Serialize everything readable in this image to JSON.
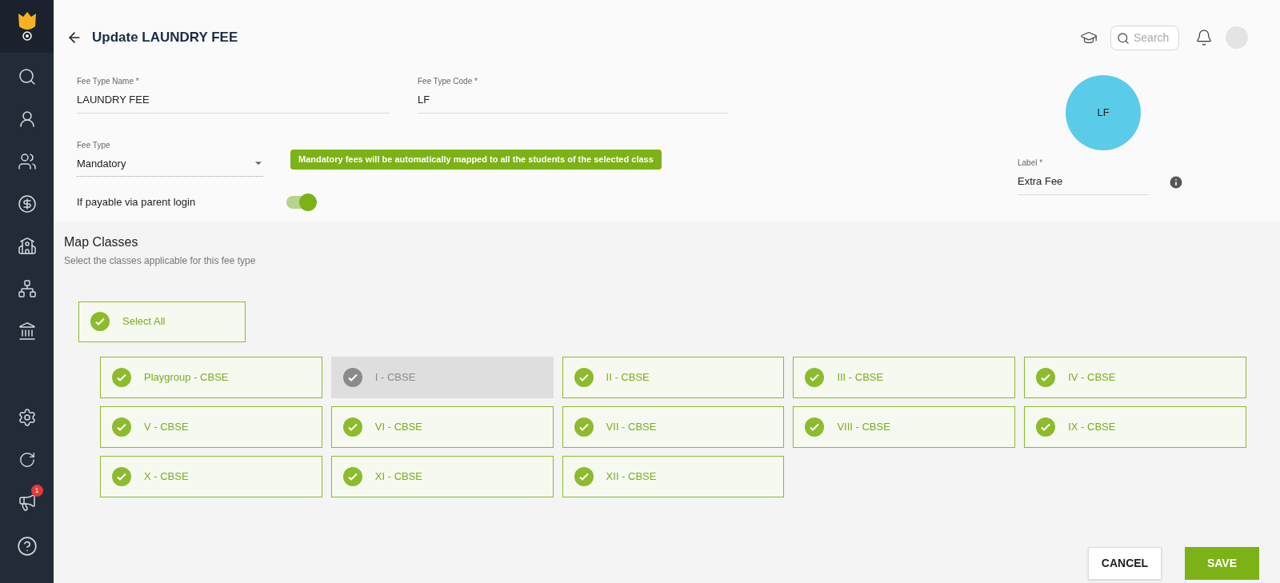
{
  "sidebar": {
    "badge": "1"
  },
  "header": {
    "title": "Update LAUNDRY FEE",
    "search": {
      "placeholder": "Search"
    }
  },
  "form": {
    "fee_type_name": {
      "label": "Fee Type Name *",
      "value": "LAUNDRY FEE"
    },
    "fee_type_code": {
      "label": "Fee Type Code *",
      "value": "LF"
    },
    "fee_type": {
      "label": "Fee Type",
      "value": "Mandatory"
    },
    "notice": "Mandatory fees will be automatically mapped to all the students of the selected class",
    "parent_login": {
      "label": "If payable via parent login",
      "on": true
    },
    "avatar": {
      "initials": "LF",
      "color": "#5bcbea"
    },
    "label_field": {
      "label": "Label *",
      "value": "Extra Fee"
    }
  },
  "map_classes": {
    "title": "Map Classes",
    "subtitle": "Select the classes applicable for this fee type",
    "select_all": {
      "label": "Select All",
      "checked": true
    },
    "classes": [
      {
        "label": "Playgroup - CBSE",
        "checked": true,
        "disabled": false
      },
      {
        "label": "I - CBSE",
        "checked": true,
        "disabled": true
      },
      {
        "label": "II - CBSE",
        "checked": true,
        "disabled": false
      },
      {
        "label": "III - CBSE",
        "checked": true,
        "disabled": false
      },
      {
        "label": "IV - CBSE",
        "checked": true,
        "disabled": false
      },
      {
        "label": "V - CBSE",
        "checked": true,
        "disabled": false
      },
      {
        "label": "VI - CBSE",
        "checked": true,
        "disabled": false
      },
      {
        "label": "VII - CBSE",
        "checked": true,
        "disabled": false
      },
      {
        "label": "VIII - CBSE",
        "checked": true,
        "disabled": false
      },
      {
        "label": "IX - CBSE",
        "checked": true,
        "disabled": false
      },
      {
        "label": "X - CBSE",
        "checked": true,
        "disabled": false
      },
      {
        "label": "XI - CBSE",
        "checked": true,
        "disabled": false
      },
      {
        "label": "XII - CBSE",
        "checked": true,
        "disabled": false
      }
    ]
  },
  "buttons": {
    "cancel": "CANCEL",
    "save": "SAVE"
  }
}
